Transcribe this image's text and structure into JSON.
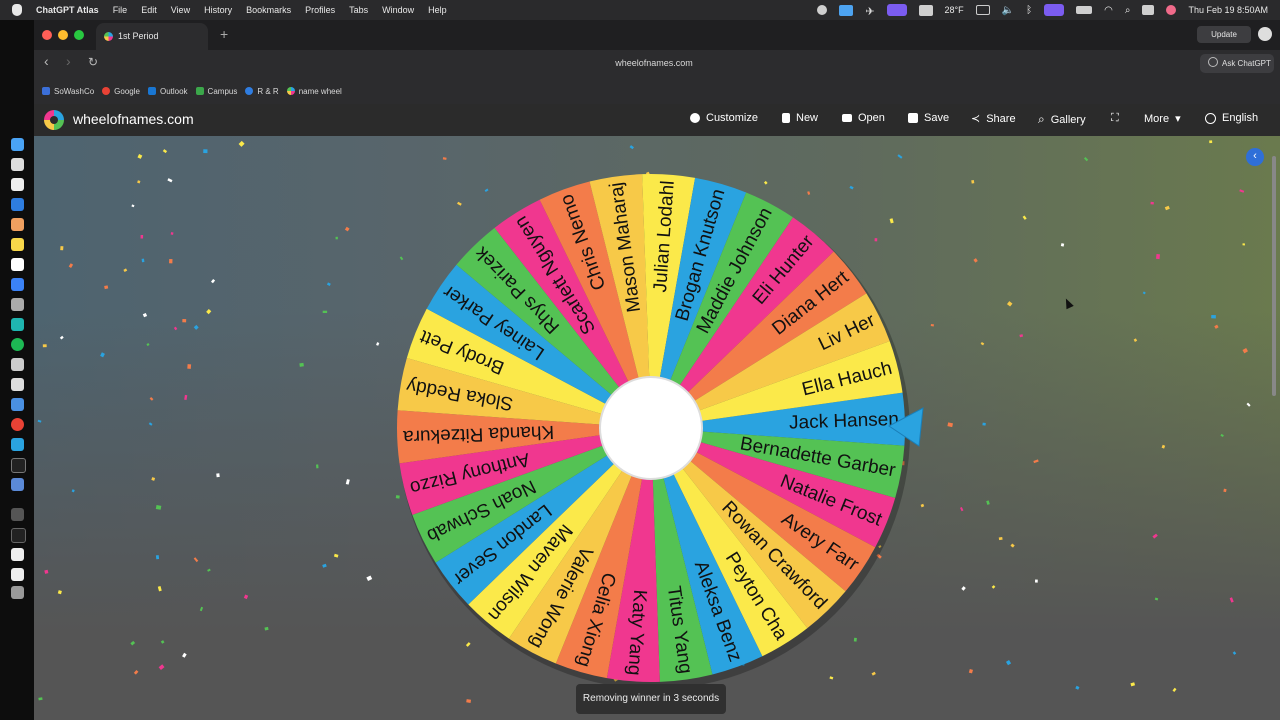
{
  "menubar": {
    "app": "ChatGPT Atlas",
    "items": [
      "File",
      "Edit",
      "View",
      "History",
      "Bookmarks",
      "Profiles",
      "Tabs",
      "Window",
      "Help"
    ],
    "temperature": "28°F",
    "clock": "Thu Feb 19  8:50AM"
  },
  "browser": {
    "tab_title": "1st Period",
    "new_tab": "+",
    "update_label": "Update",
    "url": "wheelofnames.com",
    "ask_label": "Ask ChatGPT",
    "back": "‹",
    "forward": "›",
    "reload": "↻"
  },
  "bookmarks": [
    {
      "label": "SoWashCo",
      "color": "#3b6fd8"
    },
    {
      "label": "Google",
      "color": "#e94235"
    },
    {
      "label": "Outlook",
      "color": "#1976d2"
    },
    {
      "label": "Campus",
      "color": "#3ba74a"
    },
    {
      "label": "R & R",
      "color": "#2f7de1"
    },
    {
      "label": "name wheel",
      "color": "#f0378f"
    }
  ],
  "site": {
    "title": "wheelofnames.com",
    "nav": {
      "customize": "Customize",
      "new": "New",
      "open": "Open",
      "save": "Save",
      "share": "Share",
      "gallery": "Gallery",
      "fullscreen": "⛶",
      "more": "More",
      "more_caret": "▾",
      "language": "English"
    },
    "collapse": "‹",
    "toast": "Removing winner in 3 seconds"
  },
  "wheel": {
    "pointer_color": "#2aa3e0",
    "segment_colors": [
      "#2aa3e0",
      "#54c254",
      "#f0378f",
      "#f37c4a",
      "#f7c948",
      "#fbe94a"
    ],
    "names": [
      "Jack Hansen",
      "Bernadette Garber",
      "Natalie Frost",
      "Avery Farr",
      "Rowan Crawford",
      "Peyton Cha",
      "Aleksa Benz",
      "Titus Yang",
      "Katy Yang",
      "Celia Xiong",
      "Valerie Wong",
      "Maven Wilson",
      "Landon Sever",
      "Noah Schwab",
      "Anthony Rizzo",
      "Khanda Ritzekura",
      "Sloka Reddy",
      "Brody Pett",
      "Lainey Parker",
      "Rhys Parizek",
      "Scarlett Nguyen",
      "Chris Nemo",
      "Mason Maharaj",
      "Julian Lodahl",
      "Brogan Knutson",
      "Maddie Johnson",
      "Eli Hunter",
      "Diana Hert",
      "Liv Her",
      "Ella Hauch"
    ]
  }
}
